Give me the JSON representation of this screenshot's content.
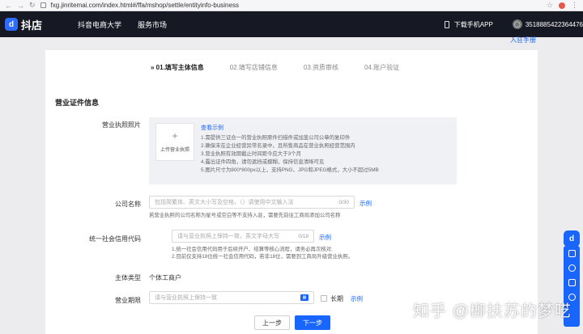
{
  "browser": {
    "url": "fxg.jinritemai.com/index.html#/ffa/mshop/settle/entityinfo-business"
  },
  "topbar": {
    "logo_mark": "d",
    "logo_text": "抖店",
    "nav": [
      "抖音电商大学",
      "服务市场"
    ],
    "download_app": "下载手机APP",
    "account_id": "3518885422364476"
  },
  "card": {
    "help_link": "入驻手册",
    "steps": [
      "» 01.填写主体信息",
      "02.填写店铺信息",
      "03.资质审核",
      "04.账户验证"
    ],
    "section_title": "营业证件信息",
    "license": {
      "label": "营业执照照片",
      "upload_text": "上传营业执照",
      "example": "查看示例",
      "requirements": [
        "1.需提供三证合一的营业执照原件扫描件或加盖公司公章的复印件",
        "2.确保未在企业经营异常名录中，且所售商品在营业执照经营范围内",
        "3.营业执照有效期截止时间距今应大于3个月",
        "4.露出证件四角，请勿遮挡或模糊，保持信息清晰可见",
        "5.图片尺寸为800*800px以上，支持PNG、JPG和JPEG格式，大小不超过5MB"
      ]
    },
    "company_name": {
      "label": "公司名称",
      "placeholder": "包括简繁体、英文大小写及空格，（）请使用中文输入法",
      "count": "0/30",
      "example": "示例",
      "hint": "若营业执照的公司名称为星号或空白等不支持入驻，需要先前往工商局添加公司名称"
    },
    "credit_code": {
      "label": "统一社会信用代码",
      "placeholder": "请与营业执照上保持一致，英文字母大写",
      "count": "0/18",
      "example": "示例",
      "hint_lines": [
        "1.统一社会信用代码用于后续开户、结算等核心流程，请务必再次核对;",
        "2.目前仅支持18位统一社会信用代码，若非18位，需要到工商局升级营业执照。"
      ]
    },
    "entity_type": {
      "label": "主体类型",
      "value": "个体工商户"
    },
    "business_term": {
      "label": "营业期限",
      "placeholder": "请与营业执照上保持一致",
      "long_term": "长期",
      "example": "示例"
    },
    "buttons": {
      "prev": "上一步",
      "next": "下一步"
    }
  },
  "floating": {
    "logo": "d"
  },
  "watermark": "知乎 @柳扶苏的梦呓",
  "colors": {
    "accent": "#1966ff",
    "topbar_bg": "#161823"
  }
}
